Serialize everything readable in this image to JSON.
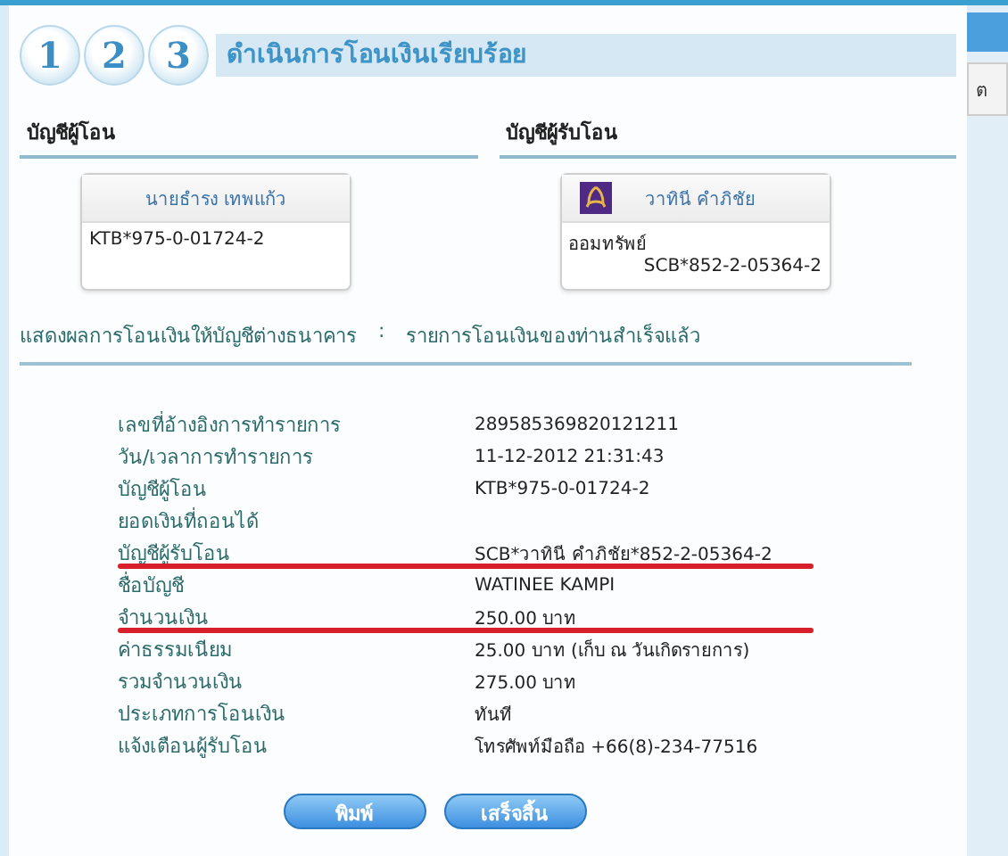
{
  "steps": [
    "1",
    "2",
    "3"
  ],
  "title": "ดำเนินการโอนเงินเรียบร้อย",
  "from": {
    "heading": "บัญชีผู้โอน",
    "name": "นายธำรง เทพแก้ว",
    "account": "KTB*975-0-01724-2"
  },
  "to": {
    "heading": "บัญชีผู้รับโอน",
    "name": "วาทินี คำภิชัย",
    "account_type": "ออมทรัพย์",
    "account": "SCB*852-2-05364-2"
  },
  "result": {
    "label": "แสดงผลการโอนเงินให้บัญชีต่างธนาคาร",
    "separator": ":",
    "status": "รายการโอนเงินของท่านสำเร็จแล้ว"
  },
  "details": [
    {
      "label": "เลขที่อ้างอิงการทำรายการ",
      "value": "289585369820121211",
      "highlighted": false
    },
    {
      "label": "วัน/เวลาการทำรายการ",
      "value": "11-12-2012 21:31:43",
      "highlighted": false
    },
    {
      "label": "บัญชีผู้โอน",
      "value": "KTB*975-0-01724-2",
      "highlighted": false
    },
    {
      "label": "ยอดเงินที่ถอนได้",
      "highlighted": false
    },
    {
      "label": "บัญชีผู้รับโอน",
      "value": "SCB*วาทินี คำภิชัย*852-2-05364-2",
      "highlighted": true
    },
    {
      "label": "ชื่อบัญชี",
      "value": "WATINEE KAMPI",
      "highlighted": false
    },
    {
      "label": "จำนวนเงิน",
      "value": "250.00 บาท",
      "highlighted": true
    },
    {
      "label": "ค่าธรรมเนียม",
      "value": "25.00 บาท (เก็บ ณ วันเกิดรายการ)",
      "highlighted": false
    },
    {
      "label": "รวมจำนวนเงิน",
      "value": "275.00 บาท",
      "highlighted": false
    },
    {
      "label": "ประเภทการโอนเงิน",
      "value": "ทันที",
      "highlighted": false
    },
    {
      "label": "แจ้งเตือนผู้รับโอน",
      "value": "โทรศัพท์มือถือ +66(8)-234-77516",
      "highlighted": false
    }
  ],
  "buttons": [
    "พิมพ์",
    "เสร็จสิ้น"
  ],
  "sidebar": {
    "tab": "ต"
  }
}
